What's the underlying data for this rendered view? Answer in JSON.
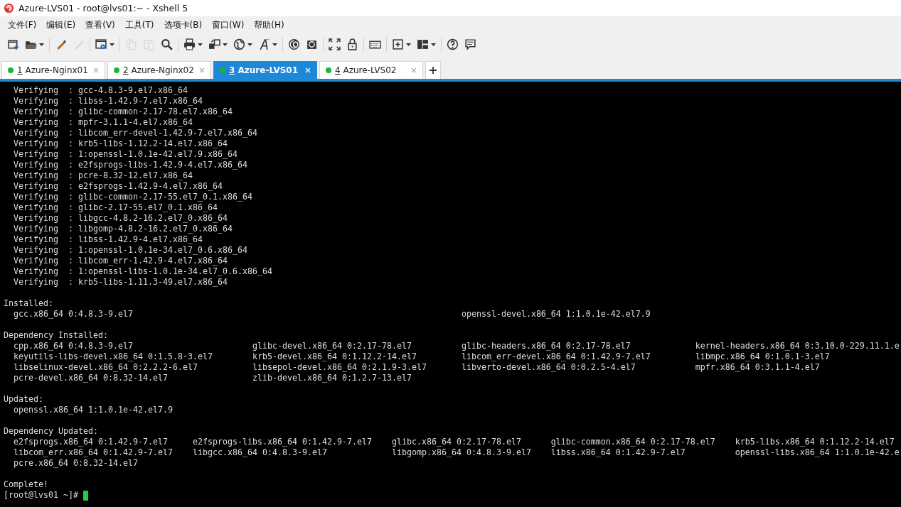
{
  "window": {
    "title": "Azure-LVS01 - root@lvs01:~ - Xshell 5"
  },
  "menu": [
    "文件(F)",
    "编辑(E)",
    "查看(V)",
    "工具(T)",
    "选项卡(B)",
    "窗口(W)",
    "帮助(H)"
  ],
  "toolbar": {
    "groups": [
      [
        {
          "kind": "newsession",
          "disabled": false,
          "dropdown": false
        },
        {
          "kind": "open",
          "disabled": false,
          "dropdown": true
        }
      ],
      [
        {
          "kind": "connect",
          "disabled": false,
          "dropdown": false
        },
        {
          "kind": "disconnect",
          "disabled": true,
          "dropdown": false
        }
      ],
      [
        {
          "kind": "properties",
          "disabled": false,
          "dropdown": true
        }
      ],
      [
        {
          "kind": "copy",
          "disabled": true,
          "dropdown": false
        },
        {
          "kind": "paste",
          "disabled": true,
          "dropdown": false
        },
        {
          "kind": "find",
          "disabled": false,
          "dropdown": false
        }
      ],
      [
        {
          "kind": "print",
          "disabled": false,
          "dropdown": true
        },
        {
          "kind": "transfer",
          "disabled": false,
          "dropdown": true
        },
        {
          "kind": "globe",
          "disabled": false,
          "dropdown": true
        },
        {
          "kind": "font",
          "disabled": false,
          "dropdown": true
        }
      ],
      [
        {
          "kind": "shell",
          "disabled": false,
          "dropdown": false
        },
        {
          "kind": "shellbox",
          "disabled": false,
          "dropdown": false
        }
      ],
      [
        {
          "kind": "fullscreen",
          "disabled": false,
          "dropdown": false
        },
        {
          "kind": "lock",
          "disabled": false,
          "dropdown": false
        }
      ],
      [
        {
          "kind": "keyboard",
          "disabled": false,
          "dropdown": false
        }
      ],
      [
        {
          "kind": "newtab",
          "disabled": false,
          "dropdown": true
        },
        {
          "kind": "layout",
          "disabled": false,
          "dropdown": true
        }
      ],
      [
        {
          "kind": "help",
          "disabled": false,
          "dropdown": false
        },
        {
          "kind": "chat",
          "disabled": false,
          "dropdown": false
        }
      ]
    ]
  },
  "tabs": [
    {
      "number": "1",
      "label": "Azure-Nginx01",
      "selected": false
    },
    {
      "number": "2",
      "label": "Azure-Nginx02",
      "selected": false
    },
    {
      "number": "3",
      "label": "Azure-LVS01",
      "selected": true
    },
    {
      "number": "4",
      "label": "Azure-LVS02",
      "selected": false
    }
  ],
  "terminal": {
    "blocks": [
      {
        "lines": [
          "  Verifying  : gcc-4.8.3-9.el7.x86_64",
          "  Verifying  : libss-1.42.9-7.el7.x86_64",
          "  Verifying  : glibc-common-2.17-78.el7.x86_64",
          "  Verifying  : mpfr-3.1.1-4.el7.x86_64",
          "  Verifying  : libcom_err-devel-1.42.9-7.el7.x86_64",
          "  Verifying  : krb5-libs-1.12.2-14.el7.x86_64",
          "  Verifying  : 1:openssl-1.0.1e-42.el7.9.x86_64",
          "  Verifying  : e2fsprogs-libs-1.42.9-4.el7.x86_64",
          "  Verifying  : pcre-8.32-12.el7.x86_64",
          "  Verifying  : e2fsprogs-1.42.9-4.el7.x86_64",
          "  Verifying  : glibc-common-2.17-55.el7_0.1.x86_64",
          "  Verifying  : glibc-2.17-55.el7_0.1.x86_64",
          "  Verifying  : libgcc-4.8.2-16.2.el7_0.x86_64",
          "  Verifying  : libgomp-4.8.2-16.2.el7_0.x86_64",
          "  Verifying  : libss-1.42.9-4.el7.x86_64",
          "  Verifying  : 1:openssl-1.0.1e-34.el7_0.6.x86_64",
          "  Verifying  : libcom_err-1.42.9-4.el7.x86_64",
          "  Verifying  : 1:openssl-libs-1.0.1e-34.el7_0.6.x86_64",
          "  Verifying  : krb5-libs-1.11.3-49.el7.x86_64"
        ]
      },
      {
        "lines": [
          "Installed:",
          "  gcc.x86_64 0:4.8.3-9.el7                                                                  openssl-devel.x86_64 1:1.0.1e-42.el7.9"
        ]
      },
      {
        "lines": [
          "Dependency Installed:",
          "  cpp.x86_64 0:4.8.3-9.el7                        glibc-devel.x86_64 0:2.17-78.el7          glibc-headers.x86_64 0:2.17-78.el7             kernel-headers.x86_64 0:3.10.0-229.11.1.e",
          "  keyutils-libs-devel.x86_64 0:1.5.8-3.el7        krb5-devel.x86_64 0:1.12.2-14.el7         libcom_err-devel.x86_64 0:1.42.9-7.el7         libmpc.x86_64 0:1.0.1-3.el7",
          "  libselinux-devel.x86_64 0:2.2.2-6.el7           libsepol-devel.x86_64 0:2.1.9-3.el7       libverto-devel.x86_64 0:0.2.5-4.el7            mpfr.x86_64 0:3.1.1-4.el7",
          "  pcre-devel.x86_64 0:8.32-14.el7                 zlib-devel.x86_64 0:1.2.7-13.el7"
        ]
      },
      {
        "lines": [
          "Updated:",
          "  openssl.x86_64 1:1.0.1e-42.el7.9"
        ]
      },
      {
        "lines": [
          "Dependency Updated:",
          "  e2fsprogs.x86_64 0:1.42.9-7.el7     e2fsprogs-libs.x86_64 0:1.42.9-7.el7    glibc.x86_64 0:2.17-78.el7      glibc-common.x86_64 0:2.17-78.el7    krb5-libs.x86_64 0:1.12.2-14.el7",
          "  libcom_err.x86_64 0:1.42.9-7.el7    libgcc.x86_64 0:4.8.3-9.el7             libgomp.x86_64 0:4.8.3-9.el7    libss.x86_64 0:1.42.9-7.el7          openssl-libs.x86_64 1:1.0.1e-42.e",
          "  pcre.x86_64 0:8.32-14.el7"
        ]
      },
      {
        "lines": [
          "Complete!"
        ]
      }
    ],
    "prompt": "[root@lvs01 ~]# "
  }
}
